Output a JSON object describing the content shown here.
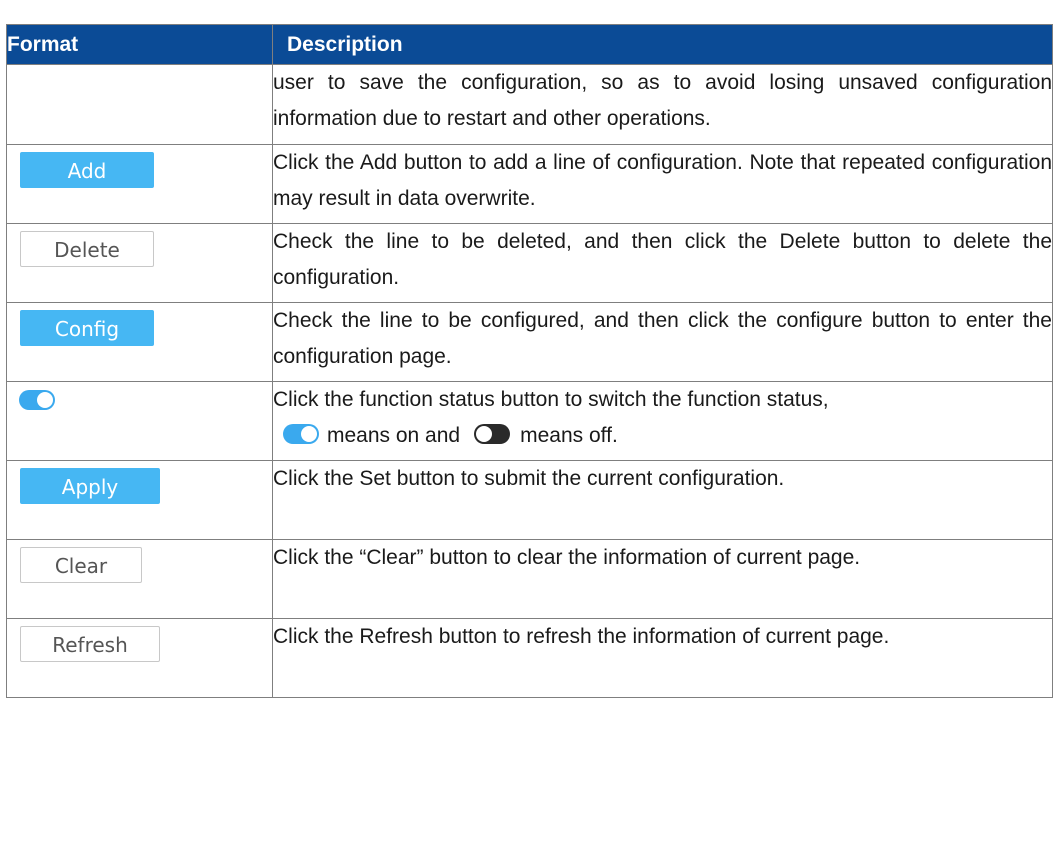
{
  "table": {
    "headers": {
      "format": "Format",
      "description": "Description"
    },
    "continued_row": {
      "description": "user to save the configuration, so as to avoid losing unsaved configuration information due to restart and other operations."
    },
    "rows": [
      {
        "button_label": "Add",
        "description": "Click the Add button to add a line of configuration. Note that repeated configuration may result in data overwrite."
      },
      {
        "button_label": "Delete",
        "description": "Check the line to be deleted, and then click the Delete button to delete the configuration."
      },
      {
        "button_label": "Config",
        "description": "Check the line to be configured, and then click the configure button to enter the configuration page."
      },
      {
        "toggle_state": "on",
        "description_before": "Click the function status button to switch the function status,",
        "means_on": "means on and",
        "means_off": "means off."
      },
      {
        "button_label": "Apply",
        "description": "Click the Set button to submit the current configuration."
      },
      {
        "button_label": "Clear",
        "description": "Click the “Clear” button to clear the information of current page."
      },
      {
        "button_label": "Refresh",
        "description": "Click the Refresh button to refresh the information of current page."
      }
    ]
  },
  "colors": {
    "header_bg": "#0b4b96",
    "primary_button": "#46b7f3",
    "toggle_on": "#3aa9ee",
    "toggle_off": "#2a2a2a"
  }
}
